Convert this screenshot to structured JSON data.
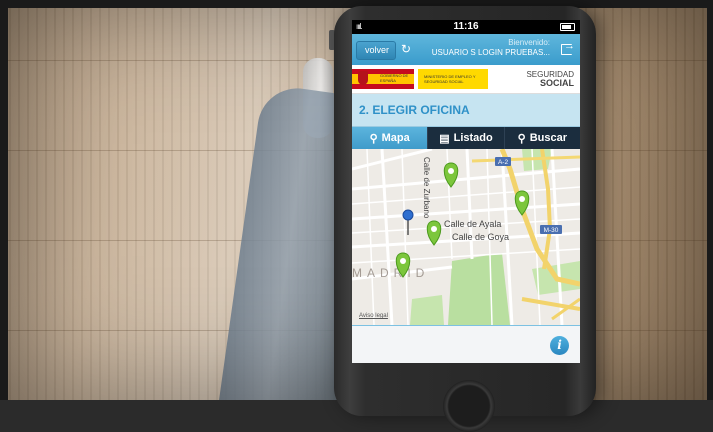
{
  "status_bar": {
    "signal": "ıııl.",
    "time": "11:16"
  },
  "navbar": {
    "back_label": "volver",
    "welcome_label": "Bienvenido:",
    "user_name": "USUARIO S LOGIN PRUEBAS..."
  },
  "gov_banner": {
    "gobierno": "GOBIERNO DE ESPAÑA",
    "ministry": "MINISTERIO DE EMPLEO Y SEGURIDAD SOCIAL",
    "seg_line1": "SEGURIDAD",
    "seg_line2": "SOCIAL"
  },
  "section_title": "2. ELEGIR OFICINA",
  "tabs": [
    {
      "label": "Mapa",
      "icon": "map-pin-icon",
      "active": true
    },
    {
      "label": "Listado",
      "icon": "document-icon",
      "active": false
    },
    {
      "label": "Buscar",
      "icon": "search-icon",
      "active": false
    }
  ],
  "map": {
    "street_zurbano": "Calle de Zurbano",
    "street_ayala": "Calle de Ayala",
    "street_goya": "Calle de Goya",
    "city": "MADRID",
    "road_a2": "A-2",
    "road_m30": "M-30",
    "aviso": "Aviso legal",
    "markers": 4
  },
  "colors": {
    "nav_blue": "#3a9ccc",
    "tab_dark": "#1b2d3e",
    "title_blue": "#2f91c8",
    "marker_green": "#7cc63c"
  }
}
